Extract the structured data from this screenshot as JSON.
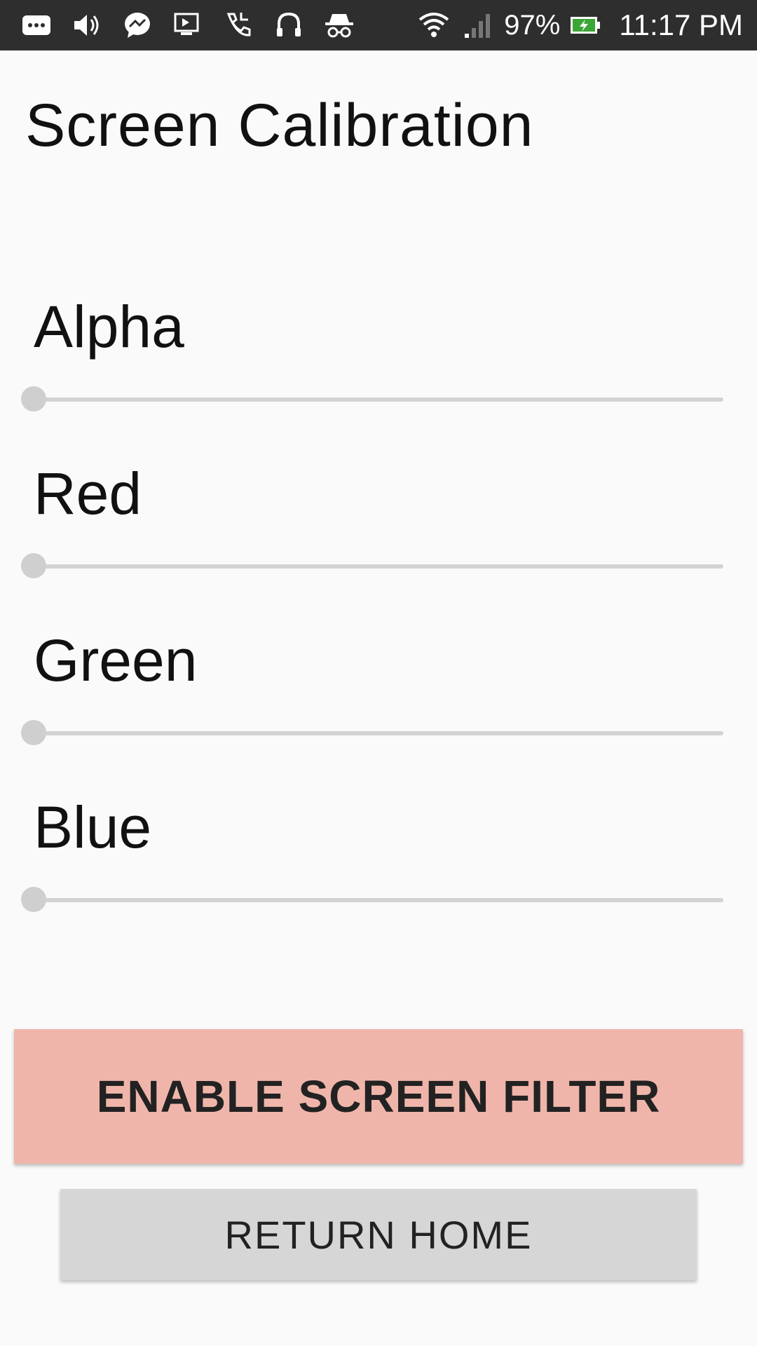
{
  "status_bar": {
    "icons": [
      "more-icon",
      "volume-icon",
      "messenger-icon",
      "cast-icon",
      "call-forward-icon",
      "headset-icon",
      "incognito-icon",
      "wifi-icon",
      "signal-icon"
    ],
    "battery_percent": "97%",
    "time": "11:17 PM"
  },
  "screen": {
    "title": "Screen Calibration"
  },
  "sliders": [
    {
      "label": "Alpha",
      "value": 0
    },
    {
      "label": "Red",
      "value": 0
    },
    {
      "label": "Green",
      "value": 0
    },
    {
      "label": "Blue",
      "value": 0
    }
  ],
  "buttons": {
    "enable_label": "ENABLE SCREEN FILTER",
    "home_label": "RETURN HOME"
  },
  "colors": {
    "background": "#fafafa",
    "enable_button": "#f0b5aa",
    "home_button": "#d6d6d6",
    "slider_track": "#d3d3d3",
    "slider_thumb": "#cfcfcf"
  }
}
